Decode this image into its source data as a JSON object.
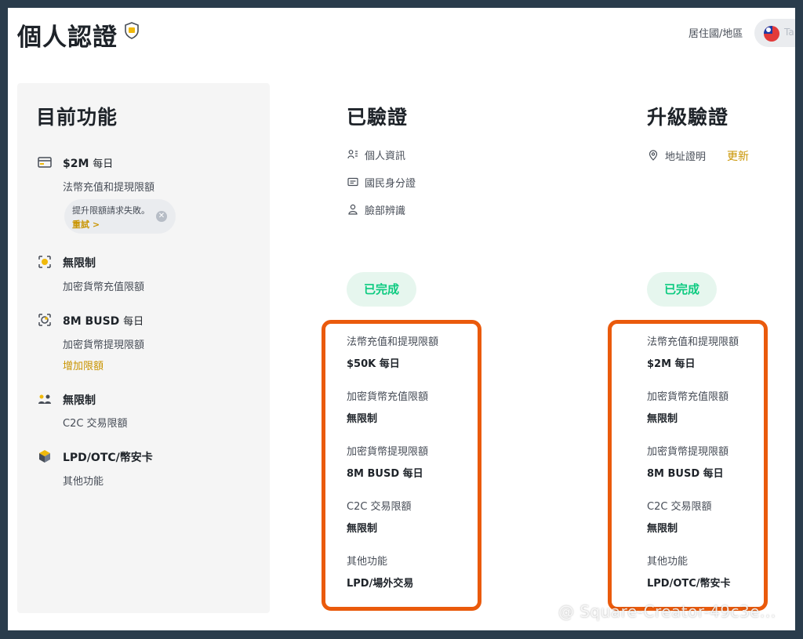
{
  "header": {
    "title": "個人認證",
    "residence_label": "居住國/地區",
    "country_abbrev": "Ta"
  },
  "current_features": {
    "title": "目前功能",
    "items": [
      {
        "icon": "card-icon",
        "main": "$2M",
        "unit": "每日",
        "sub": "法幣充值和提現限額"
      },
      {
        "icon": "crypto-deposit-icon",
        "main": "無限制",
        "unit": "",
        "sub": "加密貨幣充值限額"
      },
      {
        "icon": "crypto-withdraw-icon",
        "main": "8M BUSD",
        "unit": "每日",
        "sub": "加密貨幣提現限額",
        "link": "增加限額"
      },
      {
        "icon": "users-icon",
        "main": "無限制",
        "unit": "",
        "sub": "C2C 交易限額"
      },
      {
        "icon": "cube-icon",
        "main": "LPD/OTC/幣安卡",
        "unit": "",
        "sub": "其他功能"
      }
    ],
    "notice": {
      "text": "提升限額請求失敗。",
      "link": "重試 >"
    }
  },
  "verified": {
    "title": "已驗證",
    "items": [
      {
        "icon": "personal-info-icon",
        "label": "個人資訊"
      },
      {
        "icon": "id-card-icon",
        "label": "國民身分證"
      },
      {
        "icon": "person-icon",
        "label": "臉部辨識"
      }
    ],
    "status": "已完成",
    "limits": [
      {
        "label": "法幣充值和提現限額",
        "value": "$50K 每日"
      },
      {
        "label": "加密貨幣充值限額",
        "value": "無限制"
      },
      {
        "label": "加密貨幣提現限額",
        "value": "8M BUSD 每日"
      },
      {
        "label": "C2C 交易限額",
        "value": "無限制"
      },
      {
        "label": "其他功能",
        "value": "LPD/場外交易"
      }
    ]
  },
  "upgrade": {
    "title": "升級驗證",
    "item": {
      "icon": "location-icon",
      "label": "地址證明",
      "action": "更新"
    },
    "status": "已完成",
    "limits": [
      {
        "label": "法幣充值和提現限額",
        "value": "$2M 每日"
      },
      {
        "label": "加密貨幣充值限額",
        "value": "無限制"
      },
      {
        "label": "加密貨幣提現限額",
        "value": "8M BUSD 每日"
      },
      {
        "label": "C2C 交易限額",
        "value": "無限制"
      },
      {
        "label": "其他功能",
        "value": "LPD/OTC/幣安卡"
      }
    ]
  },
  "watermark": "@ Square-Creator-49c3e...",
  "colors": {
    "accent": "#c99400",
    "success": "#0ecb81",
    "highlight": "#ea5a0c"
  }
}
